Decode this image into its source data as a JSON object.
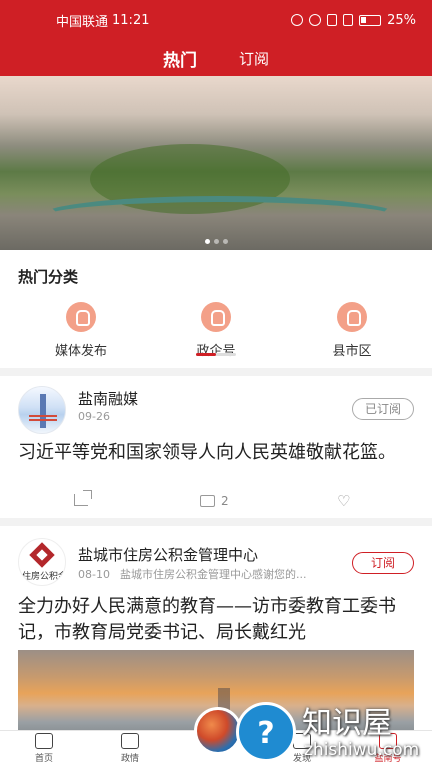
{
  "status_bar": {
    "carrier": "中国联通",
    "time": "11:21",
    "battery": "25%"
  },
  "tabs": [
    {
      "label": "热门"
    },
    {
      "label": "订阅"
    }
  ],
  "categories": {
    "title": "热门分类",
    "items": [
      {
        "label": "媒体发布"
      },
      {
        "label": "政企号"
      },
      {
        "label": "县市区"
      }
    ]
  },
  "feed": [
    {
      "source": "盐南融媒",
      "date": "09-26",
      "subscribe_label": "已订阅",
      "headline": "习近平等党和国家领导人向人民英雄敬献花篮。",
      "comments": "2"
    },
    {
      "source": "盐城市住房公积金管理中心",
      "logo_text": "住房公积金",
      "date": "08-10",
      "snippet": "盐城市住房公积金管理中心感谢您的...",
      "subscribe_label": "订阅",
      "headline": "全力办好人民满意的教育——访市委教育工委书记，市教育局党委书记、局长戴红光"
    }
  ],
  "bottom_nav": [
    {
      "label": "首页"
    },
    {
      "label": "政情"
    },
    {
      "label": "发现"
    },
    {
      "label": "盐南号"
    }
  ],
  "watermark": {
    "badge": "?",
    "title": "知识屋",
    "url": "zhishiwu.com"
  },
  "colors": {
    "brand_red": "#cf1f25",
    "category_icon": "#f3a088"
  }
}
